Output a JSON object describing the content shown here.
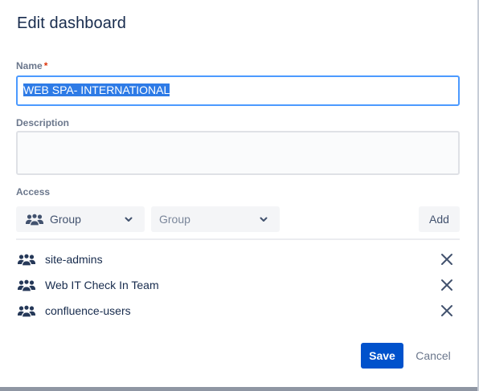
{
  "dialog": {
    "title": "Edit dashboard"
  },
  "name_field": {
    "label": "Name",
    "required_marker": "*",
    "value": "WEB SPA- INTERNATIONAL"
  },
  "description_field": {
    "label": "Description",
    "value": ""
  },
  "access": {
    "label": "Access",
    "type_select": {
      "value": "Group",
      "icon": "people-group-icon"
    },
    "group_select": {
      "placeholder": "Group"
    },
    "add_label": "Add",
    "entries": [
      {
        "name": "site-admins",
        "icon": "people-group-icon"
      },
      {
        "name": "Web IT Check In Team",
        "icon": "people-group-icon"
      },
      {
        "name": "confluence-users",
        "icon": "people-group-icon"
      }
    ]
  },
  "footer": {
    "save_label": "Save",
    "cancel_label": "Cancel"
  },
  "colors": {
    "primary": "#0052cc",
    "focus_border": "#4c9aff",
    "selection": "#2e7be6",
    "required": "#de350b"
  }
}
